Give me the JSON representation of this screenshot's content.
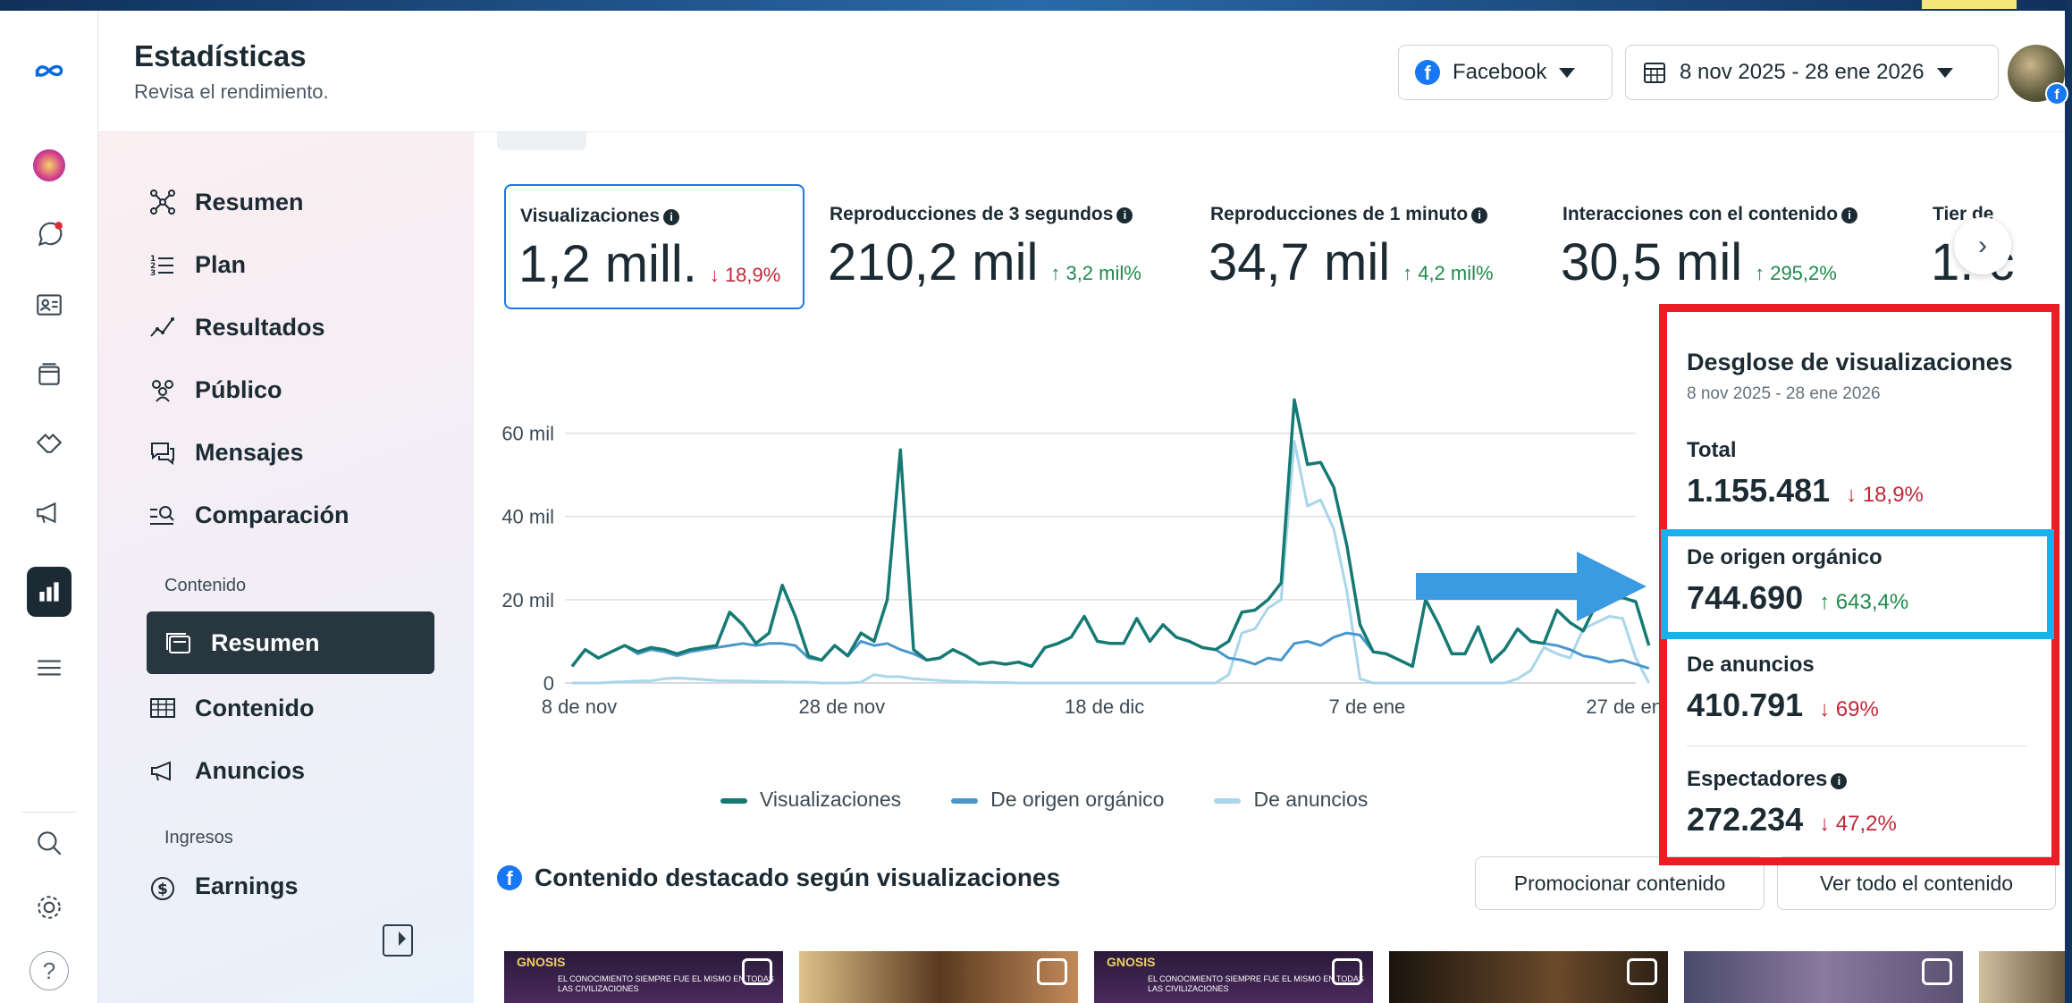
{
  "header": {
    "title": "Estadísticas",
    "subtitle": "Revisa el rendimiento.",
    "platform_label": "Facebook",
    "date_range": "8 nov 2025 - 28 ene 2026"
  },
  "rail": {
    "icons": [
      "meta-logo-icon",
      "account-avatar-icon",
      "threads-icon",
      "contacts-icon",
      "pages-icon",
      "handshake-icon",
      "megaphone-icon",
      "insights-icon",
      "menu-icon",
      "search-icon",
      "settings-icon",
      "help-icon"
    ],
    "help_glyph": "?"
  },
  "sidebar": {
    "items": [
      {
        "label": "Resumen",
        "icon": "network-icon"
      },
      {
        "label": "Plan",
        "icon": "list-icon"
      },
      {
        "label": "Resultados",
        "icon": "trend-icon"
      },
      {
        "label": "Público",
        "icon": "audience-icon"
      },
      {
        "label": "Mensajes",
        "icon": "messages-icon"
      },
      {
        "label": "Comparación",
        "icon": "compare-icon"
      }
    ],
    "section_content": "Contenido",
    "content_items": [
      {
        "label": "Resumen",
        "icon": "overview-icon",
        "active": true
      },
      {
        "label": "Contenido",
        "icon": "table-icon"
      },
      {
        "label": "Anuncios",
        "icon": "megaphone-icon"
      }
    ],
    "section_income": "Ingresos",
    "income_items": [
      {
        "label": "Earnings",
        "icon": "dollar-icon"
      }
    ]
  },
  "metrics": [
    {
      "label": "Visualizaciones",
      "value": "1,2 mill.",
      "delta": "↓ 18,9%",
      "direction": "down",
      "selected": true
    },
    {
      "label": "Reproducciones de 3 segundos",
      "value": "210,2 mil",
      "delta": "↑ 3,2 mil%",
      "direction": "up"
    },
    {
      "label": "Reproducciones de 1 minuto",
      "value": "34,7 mil",
      "delta": "↑ 4,2 mil%",
      "direction": "up"
    },
    {
      "label": "Interacciones con el contenido",
      "value": "30,5 mil",
      "delta": "↑ 295,2%",
      "direction": "up"
    },
    {
      "label": "Tier de",
      "value": "1. c",
      "delta": "",
      "direction": "up"
    }
  ],
  "chart_data": {
    "type": "line",
    "x": [
      "8 nov",
      "9 nov",
      "10 nov",
      "11 nov",
      "12 nov",
      "13 nov",
      "14 nov",
      "15 nov",
      "16 nov",
      "17 nov",
      "18 nov",
      "19 nov",
      "20 nov",
      "21 nov",
      "22 nov",
      "23 nov",
      "24 nov",
      "25 nov",
      "26 nov",
      "27 nov",
      "28 nov",
      "29 nov",
      "30 nov",
      "1 dic",
      "2 dic",
      "3 dic",
      "4 dic",
      "5 dic",
      "6 dic",
      "7 dic",
      "8 dic",
      "9 dic",
      "10 dic",
      "11 dic",
      "12 dic",
      "13 dic",
      "14 dic",
      "15 dic",
      "16 dic",
      "17 dic",
      "18 dic",
      "19 dic",
      "20 dic",
      "21 dic",
      "22 dic",
      "23 dic",
      "24 dic",
      "25 dic",
      "26 dic",
      "27 dic",
      "28 dic",
      "29 dic",
      "30 dic",
      "31 dic",
      "1 ene",
      "2 ene",
      "3 ene",
      "4 ene",
      "5 ene",
      "6 ene",
      "7 ene",
      "8 ene",
      "9 ene",
      "10 ene",
      "11 ene",
      "12 ene",
      "13 ene",
      "14 ene",
      "15 ene",
      "16 ene",
      "17 ene",
      "18 ene",
      "19 ene",
      "20 ene",
      "21 ene",
      "22 ene",
      "23 ene",
      "24 ene",
      "25 ene",
      "26 ene",
      "27 ene",
      "28 ene"
    ],
    "x_ticks": [
      "8 de nov",
      "28 de nov",
      "18 de dic",
      "7 de ene",
      "27 de ene"
    ],
    "series": [
      {
        "name": "Visualizaciones",
        "color": "#167a74",
        "values": [
          4000,
          8000,
          6000,
          7500,
          9000,
          7500,
          8500,
          8000,
          7000,
          8000,
          8500,
          9000,
          17000,
          14000,
          9500,
          12000,
          23500,
          16000,
          6500,
          5500,
          9000,
          6500,
          12000,
          10000,
          20000,
          56000,
          8000,
          5500,
          6000,
          8000,
          6500,
          4500,
          5000,
          4500,
          5000,
          4000,
          8500,
          9500,
          11000,
          16000,
          10000,
          9500,
          9500,
          15500,
          10000,
          14000,
          11000,
          10000,
          8500,
          8000,
          10000,
          17000,
          17500,
          20000,
          24000,
          68000,
          52500,
          53000,
          47000,
          33000,
          14000,
          7500,
          7000,
          5500,
          4000,
          20000,
          14000,
          7000,
          7000,
          13500,
          5000,
          8000,
          13000,
          10000,
          9500,
          17500,
          14500,
          12500,
          19000,
          20000,
          20500,
          19500,
          9000
        ]
      },
      {
        "name": "De origen orgánico",
        "color": "#4a97cc",
        "values": [
          4000,
          8000,
          6000,
          7500,
          9000,
          7000,
          8000,
          7500,
          6500,
          7500,
          8000,
          8500,
          9000,
          9500,
          9000,
          9500,
          9500,
          9000,
          6000,
          5500,
          9000,
          6500,
          10000,
          9000,
          9500,
          8000,
          7000,
          5500,
          6000,
          8000,
          6500,
          4500,
          5000,
          4500,
          5000,
          4000,
          8500,
          9500,
          11000,
          16000,
          10000,
          9500,
          9500,
          15500,
          10000,
          14000,
          11000,
          10000,
          8500,
          8000,
          6000,
          5500,
          4500,
          6000,
          5500,
          9500,
          10000,
          9000,
          11000,
          12000,
          11500,
          7500,
          7000,
          5500,
          4000,
          20000,
          14000,
          7000,
          7000,
          13500,
          5000,
          8000,
          13000,
          10000,
          9500,
          9000,
          8000,
          6500,
          6000,
          5000,
          5500,
          4500,
          3500
        ]
      },
      {
        "name": "De anuncios",
        "color": "#a9d6ea",
        "values": [
          0,
          0,
          0,
          200,
          300,
          500,
          500,
          1000,
          1200,
          1000,
          800,
          600,
          500,
          500,
          400,
          300,
          300,
          200,
          200,
          0,
          0,
          0,
          200,
          2000,
          1500,
          1500,
          1000,
          800,
          600,
          400,
          300,
          200,
          100,
          100,
          0,
          0,
          0,
          0,
          0,
          0,
          0,
          0,
          0,
          0,
          0,
          0,
          0,
          0,
          0,
          0,
          2000,
          12000,
          13000,
          18000,
          20000,
          58000,
          42500,
          44000,
          37000,
          22000,
          1000,
          0,
          0,
          0,
          0,
          0,
          0,
          0,
          0,
          0,
          0,
          0,
          1000,
          3000,
          8500,
          7000,
          6000,
          13000,
          14500,
          16000,
          15500,
          6000,
          0
        ]
      }
    ],
    "ylim": [
      0,
      70000
    ],
    "y_ticks": [
      "0",
      "20 mil",
      "40 mil",
      "60 mil"
    ],
    "y_tick_values": [
      0,
      20000,
      40000,
      60000
    ],
    "legend_position": "bottom",
    "grid": true
  },
  "breakdown": {
    "title": "Desglose de visualizaciones",
    "date": "8 nov 2025 - 28 ene 2026",
    "total_label": "Total",
    "total_value": "1.155.481",
    "total_delta": "↓ 18,9%",
    "organic_label": "De origen orgánico",
    "organic_value": "744.690",
    "organic_delta": "↑ 643,4%",
    "ads_label": "De anuncios",
    "ads_value": "410.791",
    "ads_delta": "↓ 69%",
    "viewers_label": "Espectadores",
    "viewers_value": "272.234",
    "viewers_delta": "↓ 47,2%"
  },
  "annotations": {
    "red_box_color": "#ec1c24",
    "blue_box_color": "#15b2ec",
    "arrow_color": "#3a9be0"
  },
  "featured": {
    "title": "Contenido destacado según visualizaciones",
    "promote_label": "Promocionar contenido",
    "view_all_label": "Ver todo el contenido",
    "thumb_caption": "GNOSIS",
    "thumb_subcaption": "EL CONOCIMIENTO SIEMPRE FUE EL MISMO EN TODAS LAS CIVILIZACIONES"
  },
  "colors": {
    "accent": "#1877f2",
    "down": "#c0283a",
    "up": "#1f8a4c"
  }
}
